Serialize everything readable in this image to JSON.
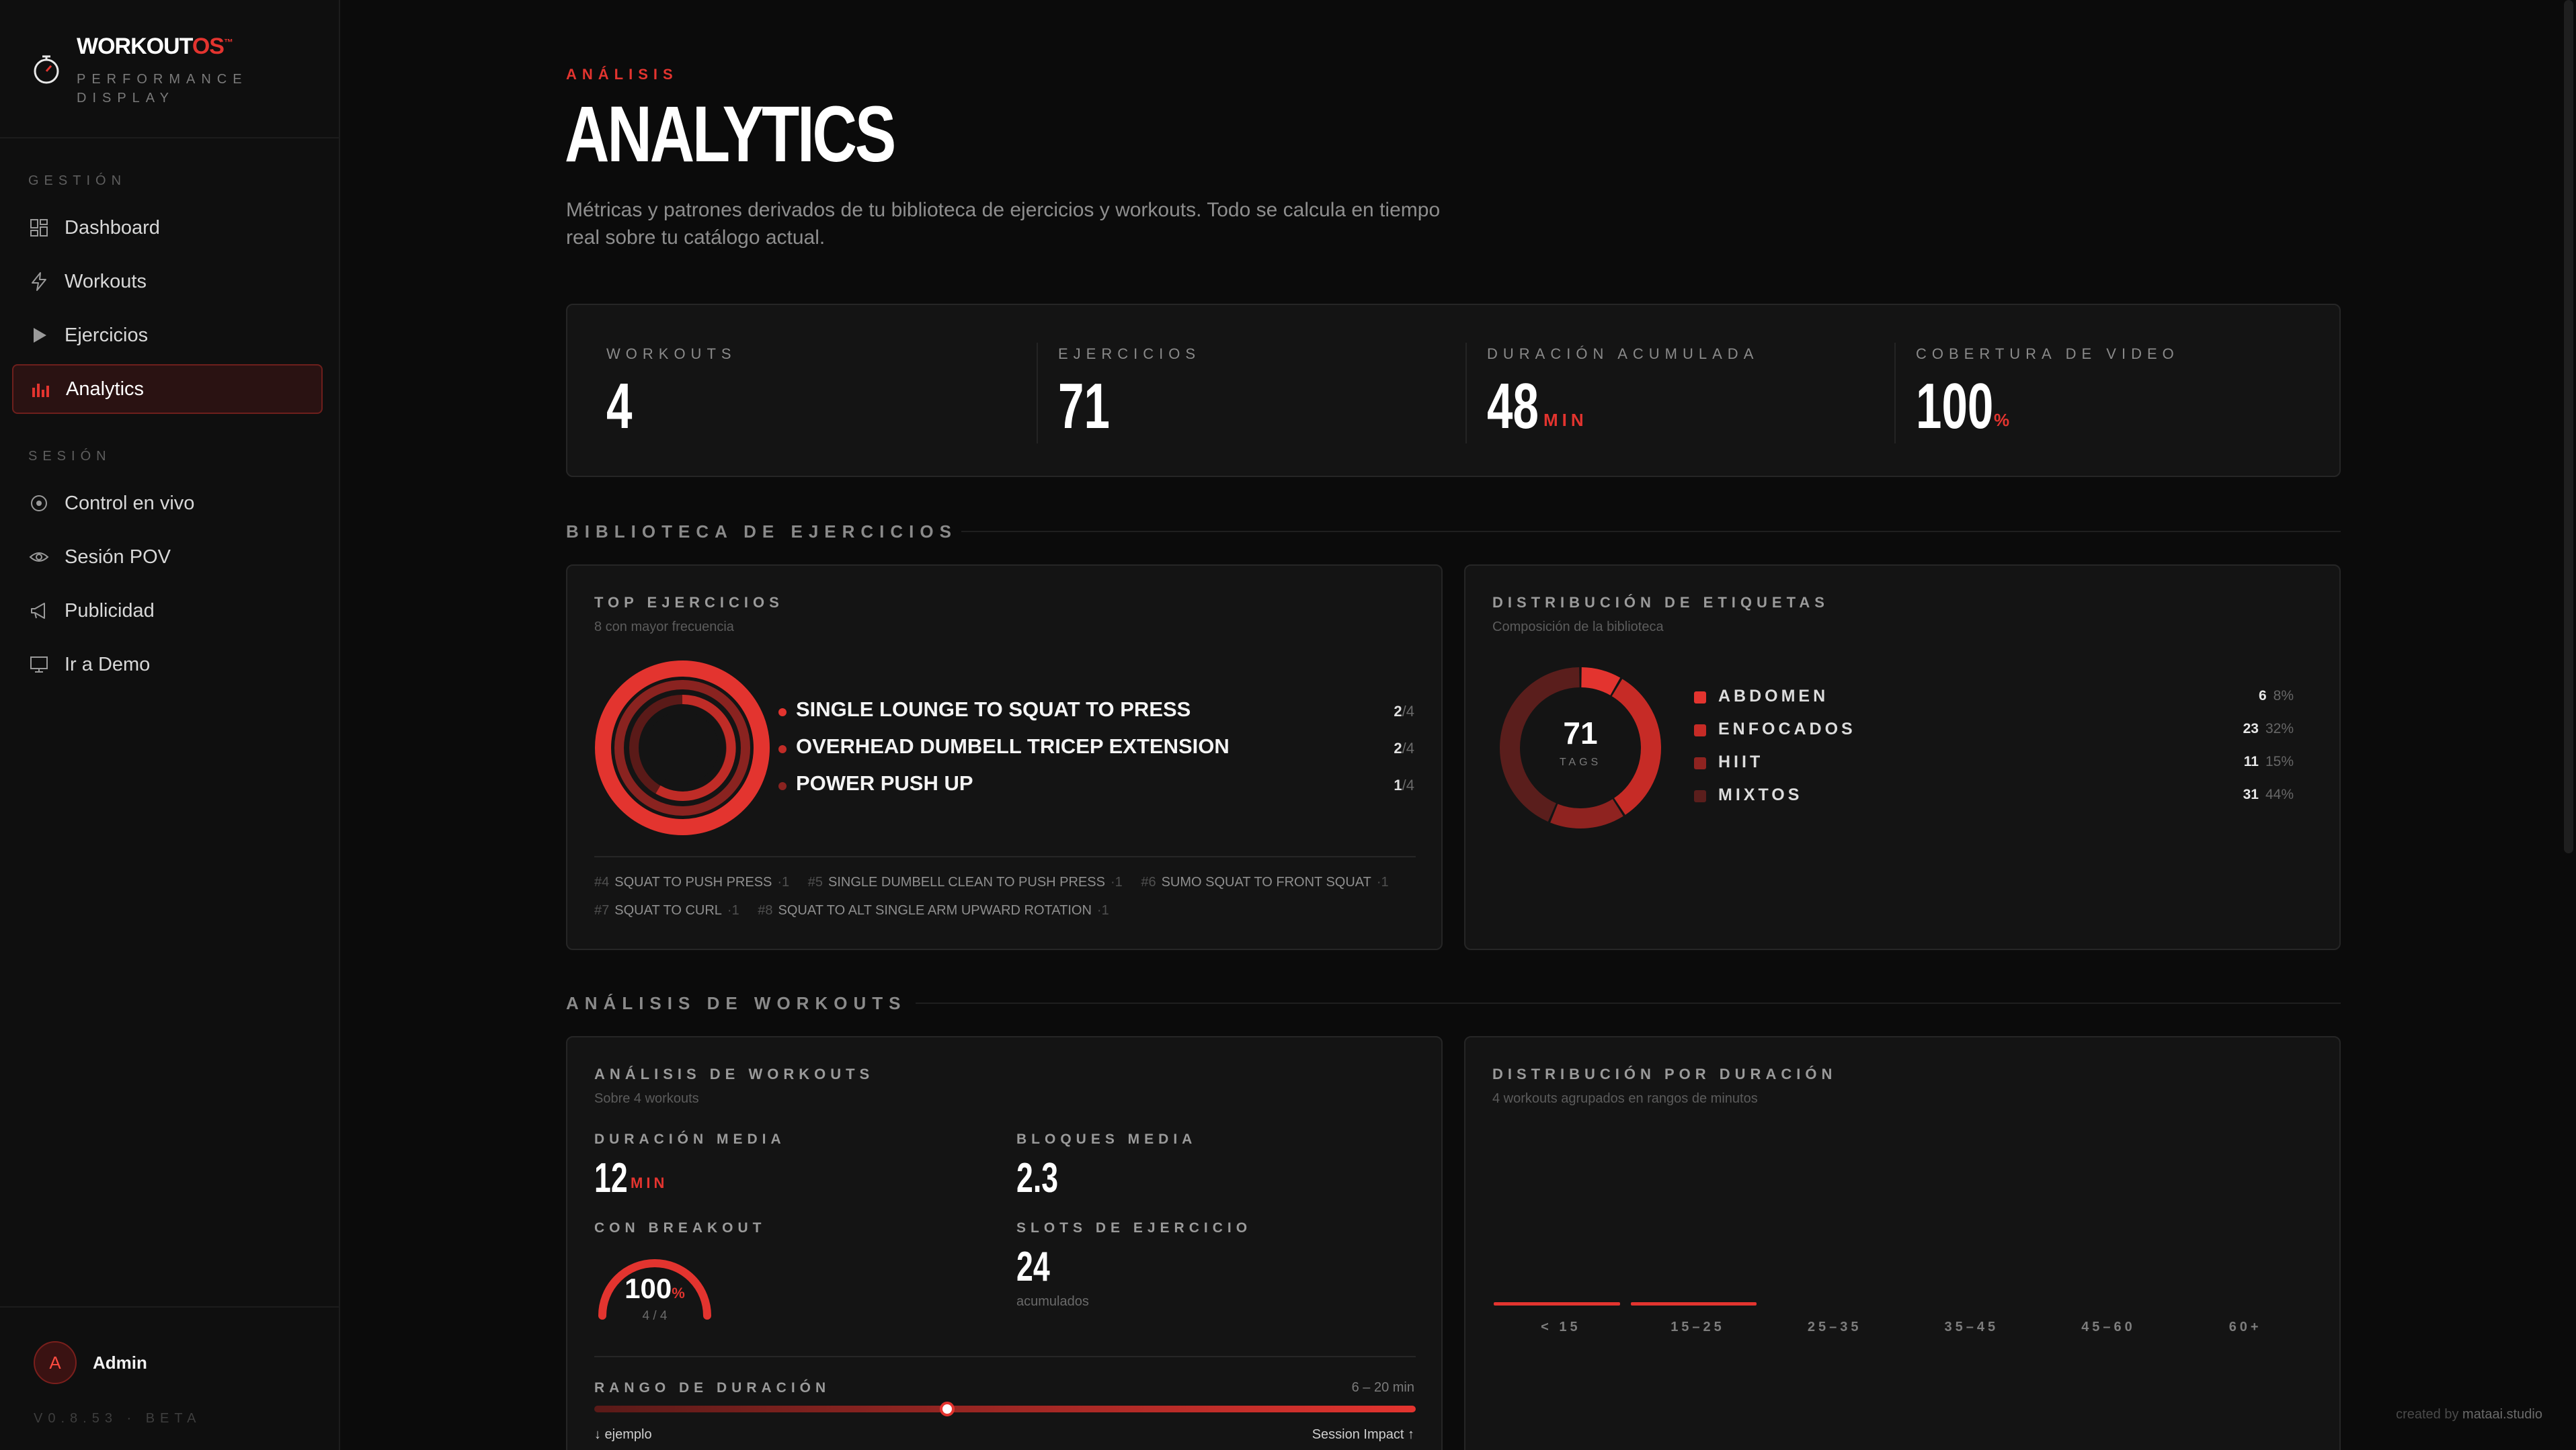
{
  "brand": {
    "name": "WORKOUT",
    "name_accent": "OS",
    "trademark": "™",
    "subtitle": "PERFORMANCE DISPLAY"
  },
  "sidebar": {
    "section_management": "GESTIÓN",
    "section_session": "SESIÓN",
    "items": [
      {
        "label": "Dashboard",
        "icon": "grid-icon"
      },
      {
        "label": "Workouts",
        "icon": "bolt-icon"
      },
      {
        "label": "Ejercicios",
        "icon": "play-icon"
      },
      {
        "label": "Analytics",
        "icon": "bar-chart-icon",
        "active": true
      },
      {
        "label": "Control en vivo",
        "icon": "target-icon"
      },
      {
        "label": "Sesión POV",
        "icon": "eye-icon"
      },
      {
        "label": "Publicidad",
        "icon": "megaphone-icon"
      },
      {
        "label": "Ir a Demo",
        "icon": "monitor-icon"
      }
    ],
    "user": {
      "initial": "A",
      "name": "Admin"
    },
    "version": "V0.8.53 · BETA"
  },
  "header": {
    "eyebrow": "ANÁLISIS",
    "title": "ANALYTICS",
    "description": "Métricas y patrones derivados de tu biblioteca de ejercicios y workouts. Todo se calcula en tiempo real sobre tu catálogo actual."
  },
  "stats": [
    {
      "label": "WORKOUTS",
      "value": "4",
      "unit": ""
    },
    {
      "label": "EJERCICIOS",
      "value": "71",
      "unit": ""
    },
    {
      "label": "DURACIÓN ACUMULADA",
      "value": "48",
      "unit": "MIN"
    },
    {
      "label": "COBERTURA DE VIDEO",
      "value": "100",
      "unit": "%"
    }
  ],
  "library": {
    "section_title": "BIBLIOTECA DE EJERCICIOS",
    "top": {
      "title": "TOP EJERCICIOS",
      "subtitle": "8 con mayor frecuencia",
      "items": [
        {
          "name": "SINGLE LOUNGE TO SQUAT TO PRESS",
          "count": "2",
          "total": "/4"
        },
        {
          "name": "OVERHEAD DUMBELL TRICEP EXTENSION",
          "count": "2",
          "total": "/4"
        },
        {
          "name": "POWER PUSH UP",
          "count": "1",
          "total": "/4"
        }
      ],
      "rest_row1": [
        {
          "rank": "#4",
          "name": "SQUAT TO PUSH PRESS",
          "count": "·1"
        },
        {
          "rank": "#5",
          "name": "SINGLE DUMBELL CLEAN TO PUSH PRESS",
          "count": "·1"
        },
        {
          "rank": "#6",
          "name": "SUMO SQUAT TO FRONT SQUAT",
          "count": "·1"
        }
      ],
      "rest_row2": [
        {
          "rank": "#7",
          "name": "SQUAT TO CURL",
          "count": "·1"
        },
        {
          "rank": "#8",
          "name": "SQUAT TO ALT SINGLE ARM UPWARD ROTATION",
          "count": "·1"
        }
      ]
    },
    "tags": {
      "title": "DISTRIBUCIÓN DE ETIQUETAS",
      "subtitle": "Composición de la biblioteca",
      "total": "71",
      "total_label": "TAGS",
      "items": [
        {
          "name": "ABDOMEN",
          "count": "6",
          "pct": "8%",
          "color": "#e3342f"
        },
        {
          "name": "ENFOCADOS",
          "count": "23",
          "pct": "32%",
          "color": "#c62b26"
        },
        {
          "name": "HIIT",
          "count": "11",
          "pct": "15%",
          "color": "#8f2320"
        },
        {
          "name": "MIXTOS",
          "count": "31",
          "pct": "44%",
          "color": "#5a1e1c"
        }
      ]
    }
  },
  "workouts": {
    "section_title": "ANÁLISIS DE WORKOUTS",
    "analysis": {
      "title": "ANÁLISIS DE WORKOUTS",
      "subtitle": "Sobre 4 workouts",
      "avg_duration_label": "DURACIÓN MEDIA",
      "avg_duration": "12",
      "avg_duration_unit": "MIN",
      "avg_blocks_label": "BLOQUES MEDIA",
      "avg_blocks": "2.3",
      "breakout_label": "CON BREAKOUT",
      "breakout_value": "100",
      "breakout_unit": "%",
      "breakout_fraction": "4 / 4",
      "breakout_ratio": 1.0,
      "slots_label": "SLOTS DE EJERCICIO",
      "slots_value": "24",
      "slots_note": "acumulados",
      "range_label": "RANGO DE DURACIÓN",
      "range_value": "6 – 20 min",
      "range_marker_fraction": 0.43,
      "range_left": "↓ ejemplo",
      "range_right": "Session Impact ↑"
    },
    "duration_dist": {
      "title": "DISTRIBUCIÓN POR DURACIÓN",
      "subtitle": "4 workouts agrupados en rangos de minutos",
      "buckets": [
        {
          "label": "< 15",
          "has_bar": true
        },
        {
          "label": "15–25",
          "has_bar": true
        },
        {
          "label": "25–35",
          "has_bar": false
        },
        {
          "label": "35–45",
          "has_bar": false
        },
        {
          "label": "45–60",
          "has_bar": false
        },
        {
          "label": "60+",
          "has_bar": false
        }
      ]
    }
  },
  "credit": {
    "prefix": "created by",
    "name": "mataai.studio"
  }
}
